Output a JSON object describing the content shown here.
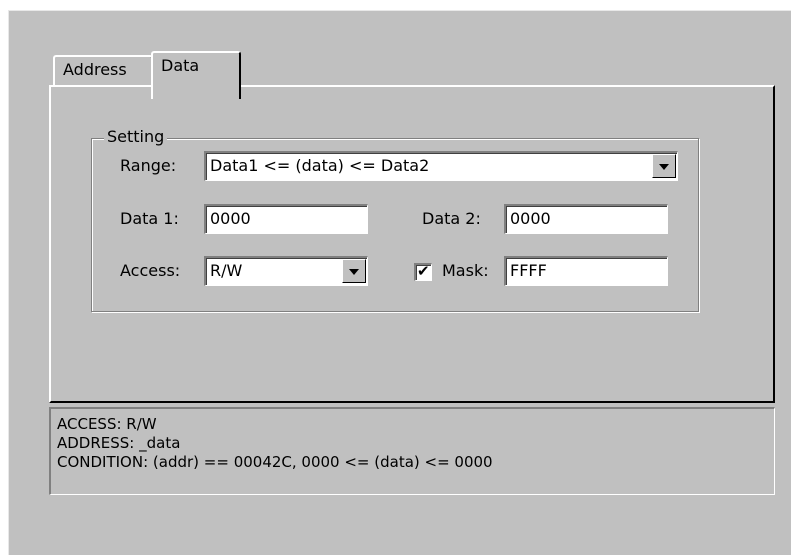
{
  "tabs": [
    {
      "label": "Address",
      "active": false
    },
    {
      "label": "Data",
      "active": true
    }
  ],
  "setting": {
    "group_label": "Setting",
    "range_label": "Range:",
    "range_value": "Data1 <= (data) <= Data2",
    "data1_label": "Data 1:",
    "data1_value": "0000",
    "data2_label": "Data 2:",
    "data2_value": "0000",
    "access_label": "Access:",
    "access_value": "R/W",
    "mask_label": "Mask:",
    "mask_checked": true,
    "mask_value": "FFFF"
  },
  "output": {
    "lines": [
      "ACCESS: R/W",
      "ADDRESS: _data",
      "CONDITION: (addr) == 00042C, 0000 <= (data) <= 0000"
    ]
  },
  "colors": {
    "face": "#c0c0c0",
    "highlight": "#ffffff",
    "shadow": "#808080",
    "dark": "#000000"
  }
}
